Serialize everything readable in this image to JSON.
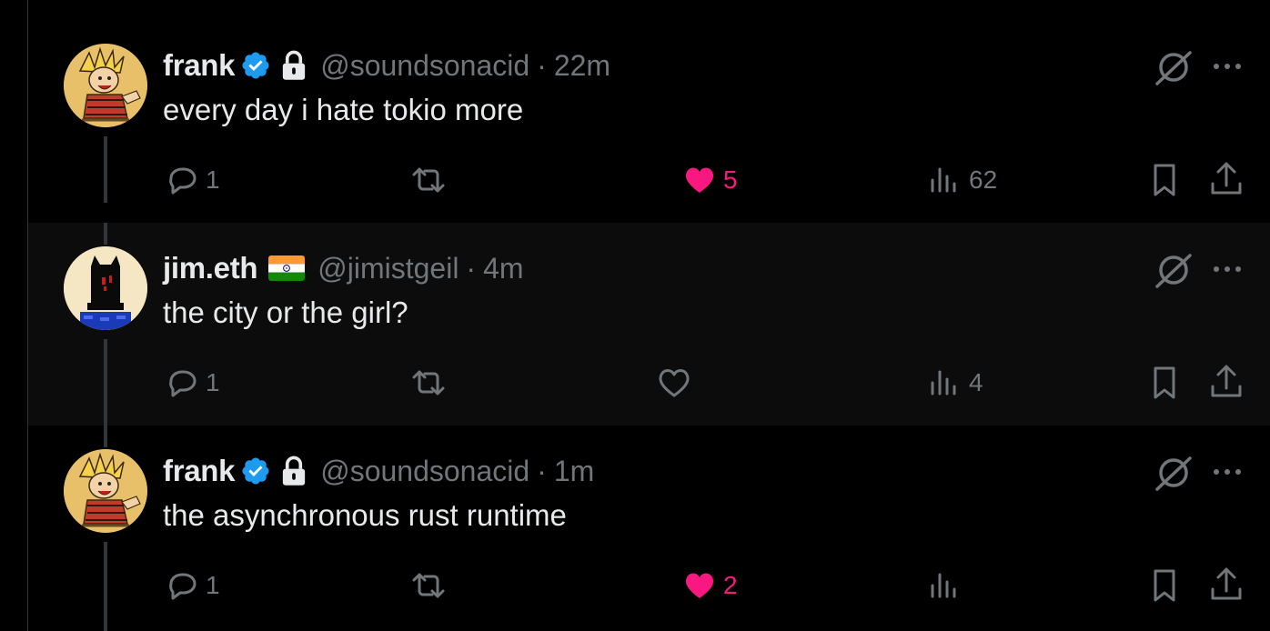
{
  "tweets": [
    {
      "author_name": "frank",
      "verified": true,
      "locked": true,
      "flag": null,
      "handle": "@soundsonacid",
      "separator": "·",
      "time": "22m",
      "text": "every day i hate tokio more",
      "reply_count": "1",
      "retweet_count": "",
      "like_count": "5",
      "liked": true,
      "view_count": "62",
      "avatar_icon": "calvin-avatar"
    },
    {
      "author_name": "jim.eth",
      "verified": false,
      "locked": false,
      "flag": "india-flag",
      "handle": "@jimistgeil",
      "separator": "·",
      "time": "4m",
      "text": "the city or the girl?",
      "reply_count": "1",
      "retweet_count": "",
      "like_count": "",
      "liked": false,
      "view_count": "4",
      "avatar_icon": "pixel-cat-avatar"
    },
    {
      "author_name": "frank",
      "verified": true,
      "locked": true,
      "flag": null,
      "handle": "@soundsonacid",
      "separator": "·",
      "time": "1m",
      "text": "the asynchronous rust runtime",
      "reply_count": "1",
      "retweet_count": "",
      "like_count": "2",
      "liked": true,
      "view_count": "",
      "avatar_icon": "calvin-avatar"
    }
  ],
  "colors": {
    "background": "#000000",
    "highlight_background": "#0c0c0c",
    "text_primary": "#e7e9ea",
    "text_secondary": "#71767b",
    "like": "#f91880",
    "verified": "#1d9bf0",
    "thread_line": "#333639"
  },
  "icons": [
    "reply-icon",
    "retweet-icon",
    "like-icon",
    "views-icon",
    "bookmark-icon",
    "share-icon",
    "grok-icon",
    "more-icon",
    "verified-icon",
    "lock-icon"
  ]
}
